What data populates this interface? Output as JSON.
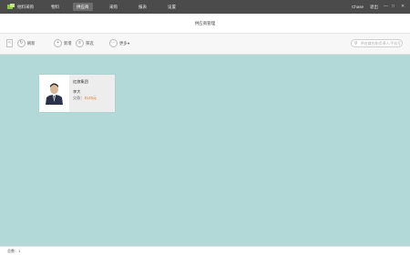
{
  "app": {
    "brand": "他料采购",
    "nav": [
      "物料",
      "供应商",
      "采购",
      "报表",
      "设置"
    ],
    "active_nav": 1,
    "user": "Chase",
    "logout": "退出",
    "window_controls": [
      "—",
      "□",
      "✕"
    ]
  },
  "page": {
    "title": "供应商管理"
  },
  "toolbar": {
    "back_icon": "<",
    "refresh_icon": "↻",
    "refresh_label": "刷新",
    "add_icon": "+",
    "add_label": "新增",
    "filter_icon": "≡",
    "filter_label": "筛选",
    "more_icon": "⋯",
    "more_label": "更多",
    "more_chevron": "▾",
    "search_icon": "⚲",
    "search_placeholder": "供应商名称/负责人/手机号"
  },
  "suppliers": [
    {
      "name": "红旗集团",
      "contact": "李大",
      "debt_label": "欠款：",
      "debt_amount": "¥145元"
    }
  ],
  "footer": {
    "total": "总数：1"
  },
  "colors": {
    "topbar": "#4b4b4b",
    "main_bg": "#b2d8d8",
    "debt_amount": "#e07a2a"
  }
}
